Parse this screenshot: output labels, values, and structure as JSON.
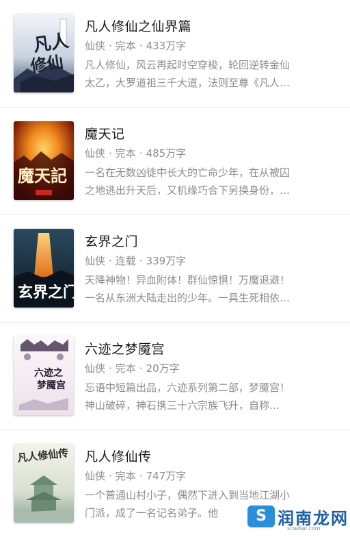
{
  "books": [
    {
      "title": "凡人修仙之仙界篇",
      "genre": "仙侠",
      "status": "完本",
      "words": "433万字",
      "desc_line1": "凡人修仙，风云再起时空穿梭，轮回逆转金仙",
      "desc_line2": "太乙，大罗道祖三千大道，法则至尊《凡人…",
      "cover_text": "凡人修仙",
      "cover_colors": [
        "#e9edf3",
        "#3b4a66"
      ]
    },
    {
      "title": "魔天记",
      "genre": "仙侠",
      "status": "完本",
      "words": "485万字",
      "desc_line1": "一名在无数凶徒中长大的亡命少年，在从被囚",
      "desc_line2": "之地逃出升天后，又机缘巧合下另换身份，…",
      "cover_text": "魔天记",
      "cover_colors": [
        "#f08a1c",
        "#3a0a06"
      ]
    },
    {
      "title": "玄界之门",
      "genre": "仙侠",
      "status": "连载",
      "words": "339万字",
      "desc_line1": "天降神物！异血附体！群仙惊惧！万魔退避！",
      "desc_line2": "一名从东洲大陆走出的少年。一具生死相依…",
      "cover_text": "玄界之门",
      "cover_colors": [
        "#e9a23a",
        "#1b3142"
      ]
    },
    {
      "title": "六迹之梦魇宫",
      "genre": "仙侠",
      "status": "完本",
      "words": "20万字",
      "desc_line1": "忘语中短篇出品，六迹系列第二部，梦魇宫！",
      "desc_line2": "神山破碎，神石携三十六宗族飞升，自称…",
      "cover_text": "六迹之梦魇宫",
      "cover_colors": [
        "#f4eef2",
        "#4a3a55"
      ]
    },
    {
      "title": "凡人修仙传",
      "genre": "仙侠",
      "status": "完本",
      "words": "747万字",
      "desc_line1": "一个普通山村小子，偶然下进入到当地江湖小",
      "desc_line2": "门派，成了一名记名弟子。他",
      "cover_text": "凡人修仙传",
      "cover_colors": [
        "#eef0e6",
        "#6b8a74"
      ]
    }
  ],
  "separator": "·",
  "watermark": {
    "logo_text": "S",
    "text": "润南龙网",
    "url": "scwdwl.com"
  }
}
